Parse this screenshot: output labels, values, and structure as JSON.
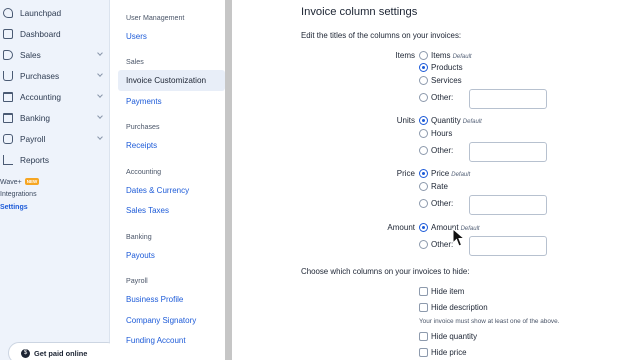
{
  "nav": {
    "items": [
      {
        "label": "Launchpad",
        "icon": "rocket-icon",
        "chevron": false
      },
      {
        "label": "Dashboard",
        "icon": "dashboard-icon",
        "chevron": false
      },
      {
        "label": "Sales",
        "icon": "tag-icon",
        "chevron": true
      },
      {
        "label": "Purchases",
        "icon": "cart-icon",
        "chevron": true
      },
      {
        "label": "Accounting",
        "icon": "accounting-icon",
        "chevron": true
      },
      {
        "label": "Banking",
        "icon": "bank-icon",
        "chevron": true
      },
      {
        "label": "Payroll",
        "icon": "payroll-icon",
        "chevron": true
      },
      {
        "label": "Reports",
        "icon": "reports-icon",
        "chevron": false
      }
    ],
    "wave_plus": "Wave+",
    "new_badge": "NEW",
    "integrations": "Integrations",
    "settings": "Settings",
    "get_paid": "Get paid online"
  },
  "subnav": {
    "user_mgmt_head": "User Management",
    "users": "Users",
    "sales_head": "Sales",
    "invoice_customization": "Invoice Customization",
    "payments": "Payments",
    "purchases_head": "Purchases",
    "receipts": "Receipts",
    "accounting_head": "Accounting",
    "dates_currency": "Dates & Currency",
    "sales_taxes": "Sales Taxes",
    "banking_head": "Banking",
    "payouts": "Payouts",
    "payroll_head": "Payroll",
    "business_profile": "Business Profile",
    "company_signatory": "Company Signatory",
    "funding_account": "Funding Account"
  },
  "form": {
    "title": "Invoice column settings",
    "intro": "Edit the titles of the columns on your invoices:",
    "default_tag": "Default",
    "items": {
      "label": "Items",
      "opt1": "Items",
      "opt2": "Products",
      "opt3": "Services",
      "other": "Other:",
      "selected": "Products"
    },
    "units": {
      "label": "Units",
      "opt1": "Quantity",
      "opt2": "Hours",
      "other": "Other:",
      "selected": "Quantity"
    },
    "price": {
      "label": "Price",
      "opt1": "Price",
      "opt2": "Rate",
      "other": "Other:",
      "selected": "Price"
    },
    "amount": {
      "label": "Amount",
      "opt1": "Amount",
      "other": "Other:",
      "selected": "Amount"
    },
    "hide_intro": "Choose which columns on your invoices to hide:",
    "hide_item": "Hide item",
    "hide_description": "Hide description",
    "hide_note": "Your invoice must show at least one of the above.",
    "hide_quantity": "Hide quantity",
    "hide_price": "Hide price"
  },
  "colors": {
    "accent": "#1d5bd8",
    "nav_bg": "#eef3fb",
    "badge": "#f6a623"
  }
}
